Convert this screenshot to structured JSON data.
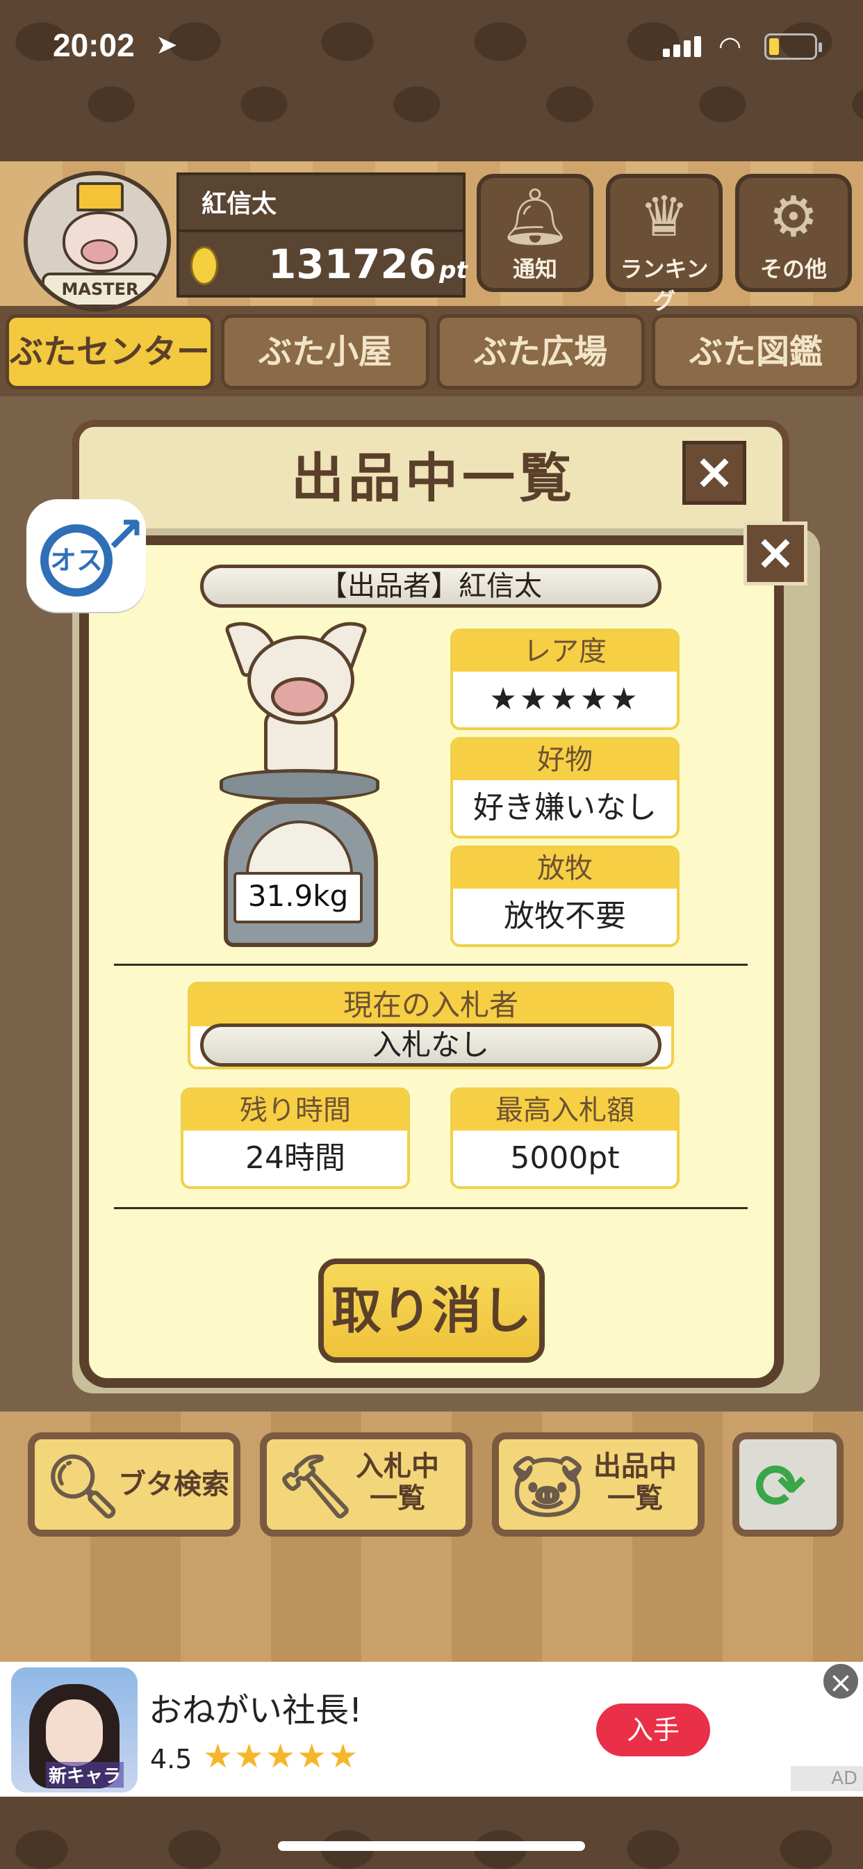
{
  "status_bar": {
    "time": "20:02"
  },
  "header": {
    "badge_text": "MASTER",
    "username": "紅信太",
    "points": "131726",
    "points_unit": "pt",
    "buttons": [
      {
        "label": "通知",
        "icon": "bell-icon"
      },
      {
        "label": "ランキング",
        "icon": "crown-icon"
      },
      {
        "label": "その他",
        "icon": "gear-icon"
      }
    ]
  },
  "tabs": [
    {
      "label": "ぶたセンター",
      "active": true
    },
    {
      "label": "ぶた小屋",
      "active": false
    },
    {
      "label": "ぶた広場",
      "active": false
    },
    {
      "label": "ぶた図鑑",
      "active": false
    }
  ],
  "list_panel": {
    "title": "出品中一覧"
  },
  "detail": {
    "gender_label": "オス",
    "seller": "【出品者】紅信太",
    "weight": "31.9kg",
    "rarity": {
      "label": "レア度",
      "stars": 5,
      "stars_text": "★★★★★"
    },
    "favorite": {
      "label": "好物",
      "value": "好き嫌いなし"
    },
    "grazing": {
      "label": "放牧",
      "value": "放牧不要"
    },
    "current_bidder": {
      "label": "現在の入札者",
      "value": "入札なし"
    },
    "time_left": {
      "label": "残り時間",
      "value": "24時間"
    },
    "max_bid": {
      "label": "最高入札額",
      "value": "5000pt"
    },
    "cancel_label": "取り消し"
  },
  "bottom_buttons": [
    {
      "label": "ブタ検索",
      "icon": "magnifier-icon"
    },
    {
      "label_line1": "入札中",
      "label_line2": "一覧",
      "icon": "gavel-icon"
    },
    {
      "label_line1": "出品中",
      "label_line2": "一覧",
      "icon": "pig-face-icon"
    },
    {
      "icon": "refresh-icon"
    }
  ],
  "ad": {
    "app_image_tag": "新キャラ",
    "title": "おねがい社長!",
    "rating": "4.5",
    "stars_text": "★★★★★",
    "button": "入手",
    "label": "AD"
  },
  "colors": {
    "accent_yellow": "#f6cf44",
    "brown": "#5b412c",
    "ad_button": "#e93048",
    "male_blue": "#2f6fb8"
  }
}
